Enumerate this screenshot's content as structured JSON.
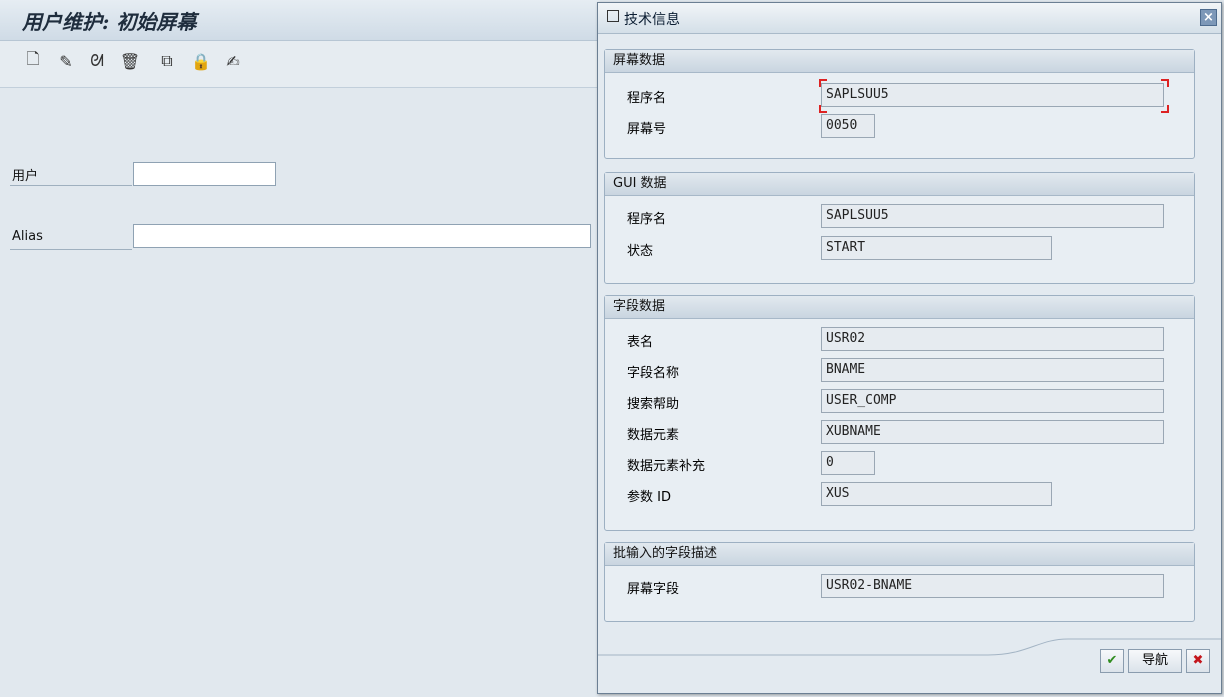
{
  "screen": {
    "title": "用户维护: 初始屏幕",
    "toolbar": {
      "icons": [
        "create-icon",
        "change-icon",
        "display-icon",
        "delete-icon",
        "copy-icon",
        "lock-icon",
        "change-documents-icon"
      ],
      "glyphs": [
        "🗋",
        "✎",
        "ᘛ",
        "🗑",
        "⧉",
        "🔒",
        "✍"
      ]
    },
    "fields": {
      "user_label": "用户",
      "user_value": "",
      "alias_label": "Alias",
      "alias_value": ""
    }
  },
  "dialog": {
    "title": "技术信息",
    "close_glyph": "×",
    "groups": {
      "screen_data": {
        "header": "屏幕数据",
        "program_label": "程序名",
        "program_value": "SAPLSUU5",
        "screen_no_label": "屏幕号",
        "screen_no_value": "0050"
      },
      "gui_data": {
        "header": "GUI 数据",
        "program_label": "程序名",
        "program_value": "SAPLSUU5",
        "status_label": "状态",
        "status_value": "START"
      },
      "field_data": {
        "header": "字段数据",
        "table_label": "表名",
        "table_value": "USR02",
        "field_label": "字段名称",
        "field_value": "BNAME",
        "search_help_label": "搜索帮助",
        "search_help_value": "USER_COMP",
        "data_element_label": "数据元素",
        "data_element_value": "XUBNAME",
        "de_supplement_label": "数据元素补充",
        "de_supplement_value": "0",
        "param_id_label": "参数 ID",
        "param_id_value": "XUS"
      },
      "batch_input": {
        "header": "批输入的字段描述",
        "screen_field_label": "屏幕字段",
        "screen_field_value": "USR02-BNAME"
      }
    },
    "buttons": {
      "ok_glyph": "✔",
      "navigate_label": "导航",
      "cancel_glyph": "✖"
    }
  },
  "colors": {
    "ok_green": "#2e8b1e",
    "cancel_red": "#c4161c",
    "focus_red": "#dd2222"
  }
}
